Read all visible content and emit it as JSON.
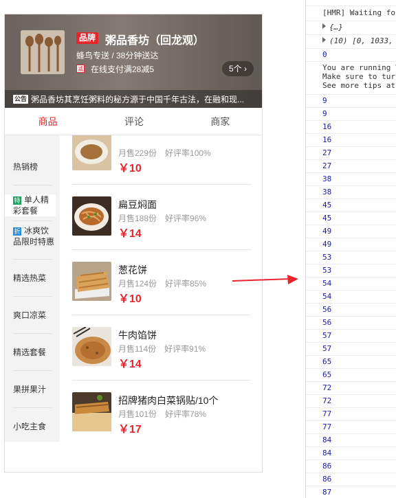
{
  "shop": {
    "brand_badge": "品牌",
    "name": "粥品香坊（回龙观）",
    "delivery": "蜂鸟专送 / 38分钟送达",
    "promo_icon": "减",
    "promo_text": "在线支付满28减5",
    "promo_count": "5个 ›",
    "notice_tag": "公告",
    "notice_text": "粥品香坊其烹饪粥料的秘方源于中国千年古法，在融和现..."
  },
  "tabs": [
    {
      "label": "商品",
      "active": true
    },
    {
      "label": "评论",
      "active": false
    },
    {
      "label": "商家",
      "active": false
    }
  ],
  "categories": [
    {
      "label": "热销榜"
    },
    {
      "icon": "特",
      "icon_color": "#19a15f",
      "label": "单人精彩套餐"
    },
    {
      "icon": "折",
      "icon_color": "#2d8cd8",
      "label": "冰爽饮品限时特惠"
    },
    {
      "label": "精选热菜"
    },
    {
      "label": "爽口凉菜"
    },
    {
      "label": "精选套餐"
    },
    {
      "label": "果拼果汁"
    },
    {
      "label": "小吃主食"
    }
  ],
  "foods": [
    {
      "name": "",
      "sales": "月售229份",
      "rating": "好评率100%",
      "price": "￥10",
      "image": "food-dish-image"
    },
    {
      "name": "扁豆焖面",
      "sales": "月售188份",
      "rating": "好评率96%",
      "price": "￥14",
      "image": "noodles-image"
    },
    {
      "name": "葱花饼",
      "sales": "月售124份",
      "rating": "好评率85%",
      "price": "￥10",
      "image": "pancake-image"
    },
    {
      "name": "牛肉馅饼",
      "sales": "月售114份",
      "rating": "好评率91%",
      "price": "￥14",
      "image": "beef-pie-image"
    },
    {
      "name": "招牌猪肉白菜锅贴/10个",
      "sales": "月售101份",
      "rating": "好评率78%",
      "price": "￥17",
      "image": "potsticker-image"
    }
  ],
  "console": {
    "hmr": "[HMR] Waiting for",
    "obj1": "{…}",
    "obj2": "(10) [0, 1033,",
    "zero": "0",
    "warn1": "You are running V",
    "warn2": "Make sure to turn",
    "warn3": "See more tips at",
    "numbers": [
      "9",
      "9",
      "16",
      "16",
      "27",
      "27",
      "38",
      "38",
      "45",
      "45",
      "49",
      "49",
      "53",
      "53",
      "54",
      "54",
      "56",
      "56",
      "57",
      "57",
      "65",
      "65",
      "72",
      "72",
      "77",
      "77",
      "84",
      "84",
      "86",
      "86",
      "87"
    ]
  },
  "colors": {
    "accent": "#e8242c",
    "console_number": "#1a1aa6"
  }
}
